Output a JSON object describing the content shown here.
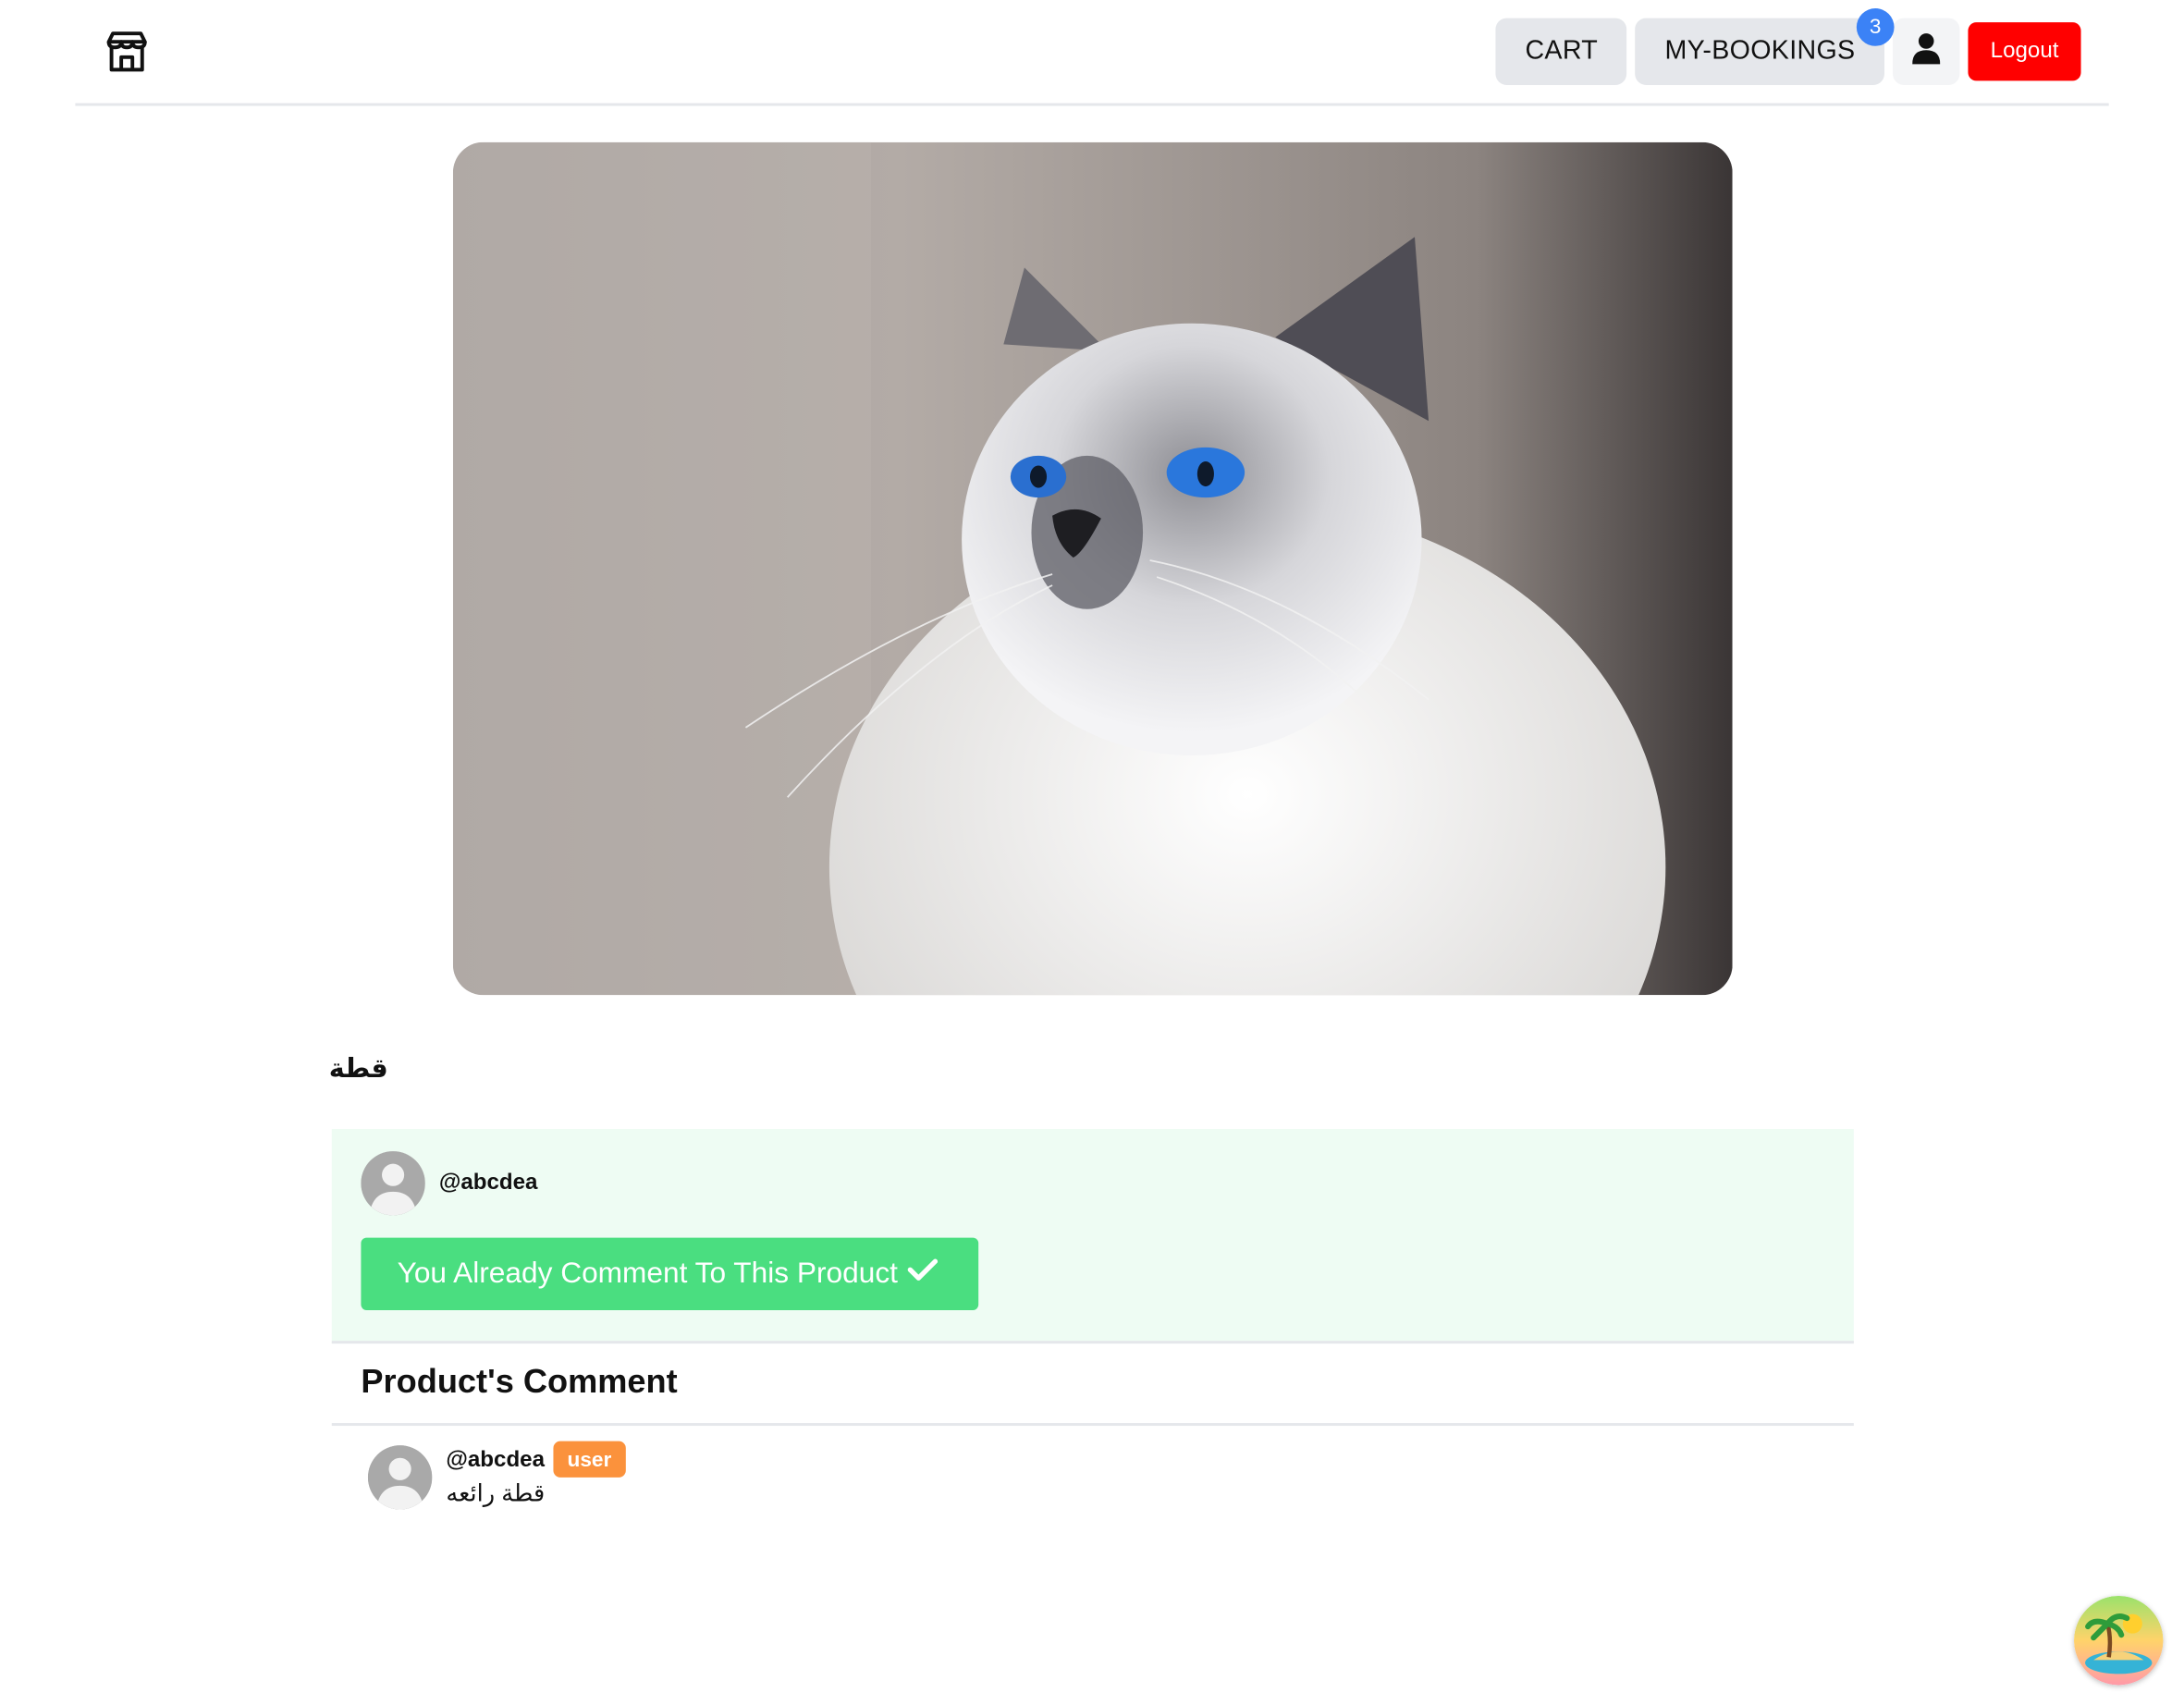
{
  "header": {
    "logo_icon": "store-icon",
    "nav": {
      "cart_label": "CART",
      "bookings_label": "MY-BOOKINGS",
      "bookings_count": "3",
      "profile_icon": "user-icon",
      "logout_label": "Logout"
    }
  },
  "product": {
    "title": "قطة"
  },
  "comment_panel": {
    "username": "@abcdea",
    "status_button": "You Already Comment To This Product",
    "status_icon": "check-icon"
  },
  "comments_section": {
    "title": "Product's Comment",
    "items": [
      {
        "username": "@abcdea",
        "role": "user",
        "text": "قطة رائعه"
      }
    ]
  },
  "colors": {
    "logout": "#ff0000",
    "badge": "#3b82f6",
    "success": "#4ade80",
    "panel_bg": "#eefcf3",
    "role_badge": "#fb923c"
  }
}
